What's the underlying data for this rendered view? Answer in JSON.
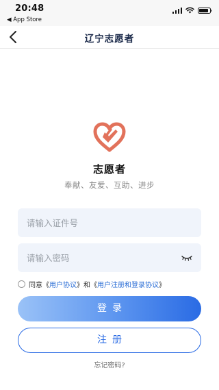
{
  "status_bar": {
    "time": "20:48",
    "back_app": "◀ App Store"
  },
  "nav": {
    "title": "辽宁志愿者",
    "back_icon": "chevron-left-icon"
  },
  "brand": {
    "logo_icon": "heart-hand-icon",
    "logo_color": "#e2725b",
    "name": "志愿者",
    "slogan": "奉献、友爱、互助、进步"
  },
  "form": {
    "id_placeholder": "请输入证件号",
    "id_value": "",
    "password_placeholder": "请输入密码",
    "password_value": "",
    "eye_icon": "eye-closed-icon"
  },
  "agreement": {
    "checked": false,
    "prefix": "同意",
    "open1": "《",
    "user_agreement": "用户协议",
    "close1": "》",
    "and": "和",
    "open2": "《",
    "register_agreement": "用户注册和登录协议",
    "close2": "》"
  },
  "actions": {
    "login_label": "登录",
    "register_label": "注册",
    "forgot_label": "忘记密码?"
  },
  "colors": {
    "accent": "#2a6be4",
    "link": "#2d6fd6",
    "field_bg": "#f0f4fb"
  }
}
